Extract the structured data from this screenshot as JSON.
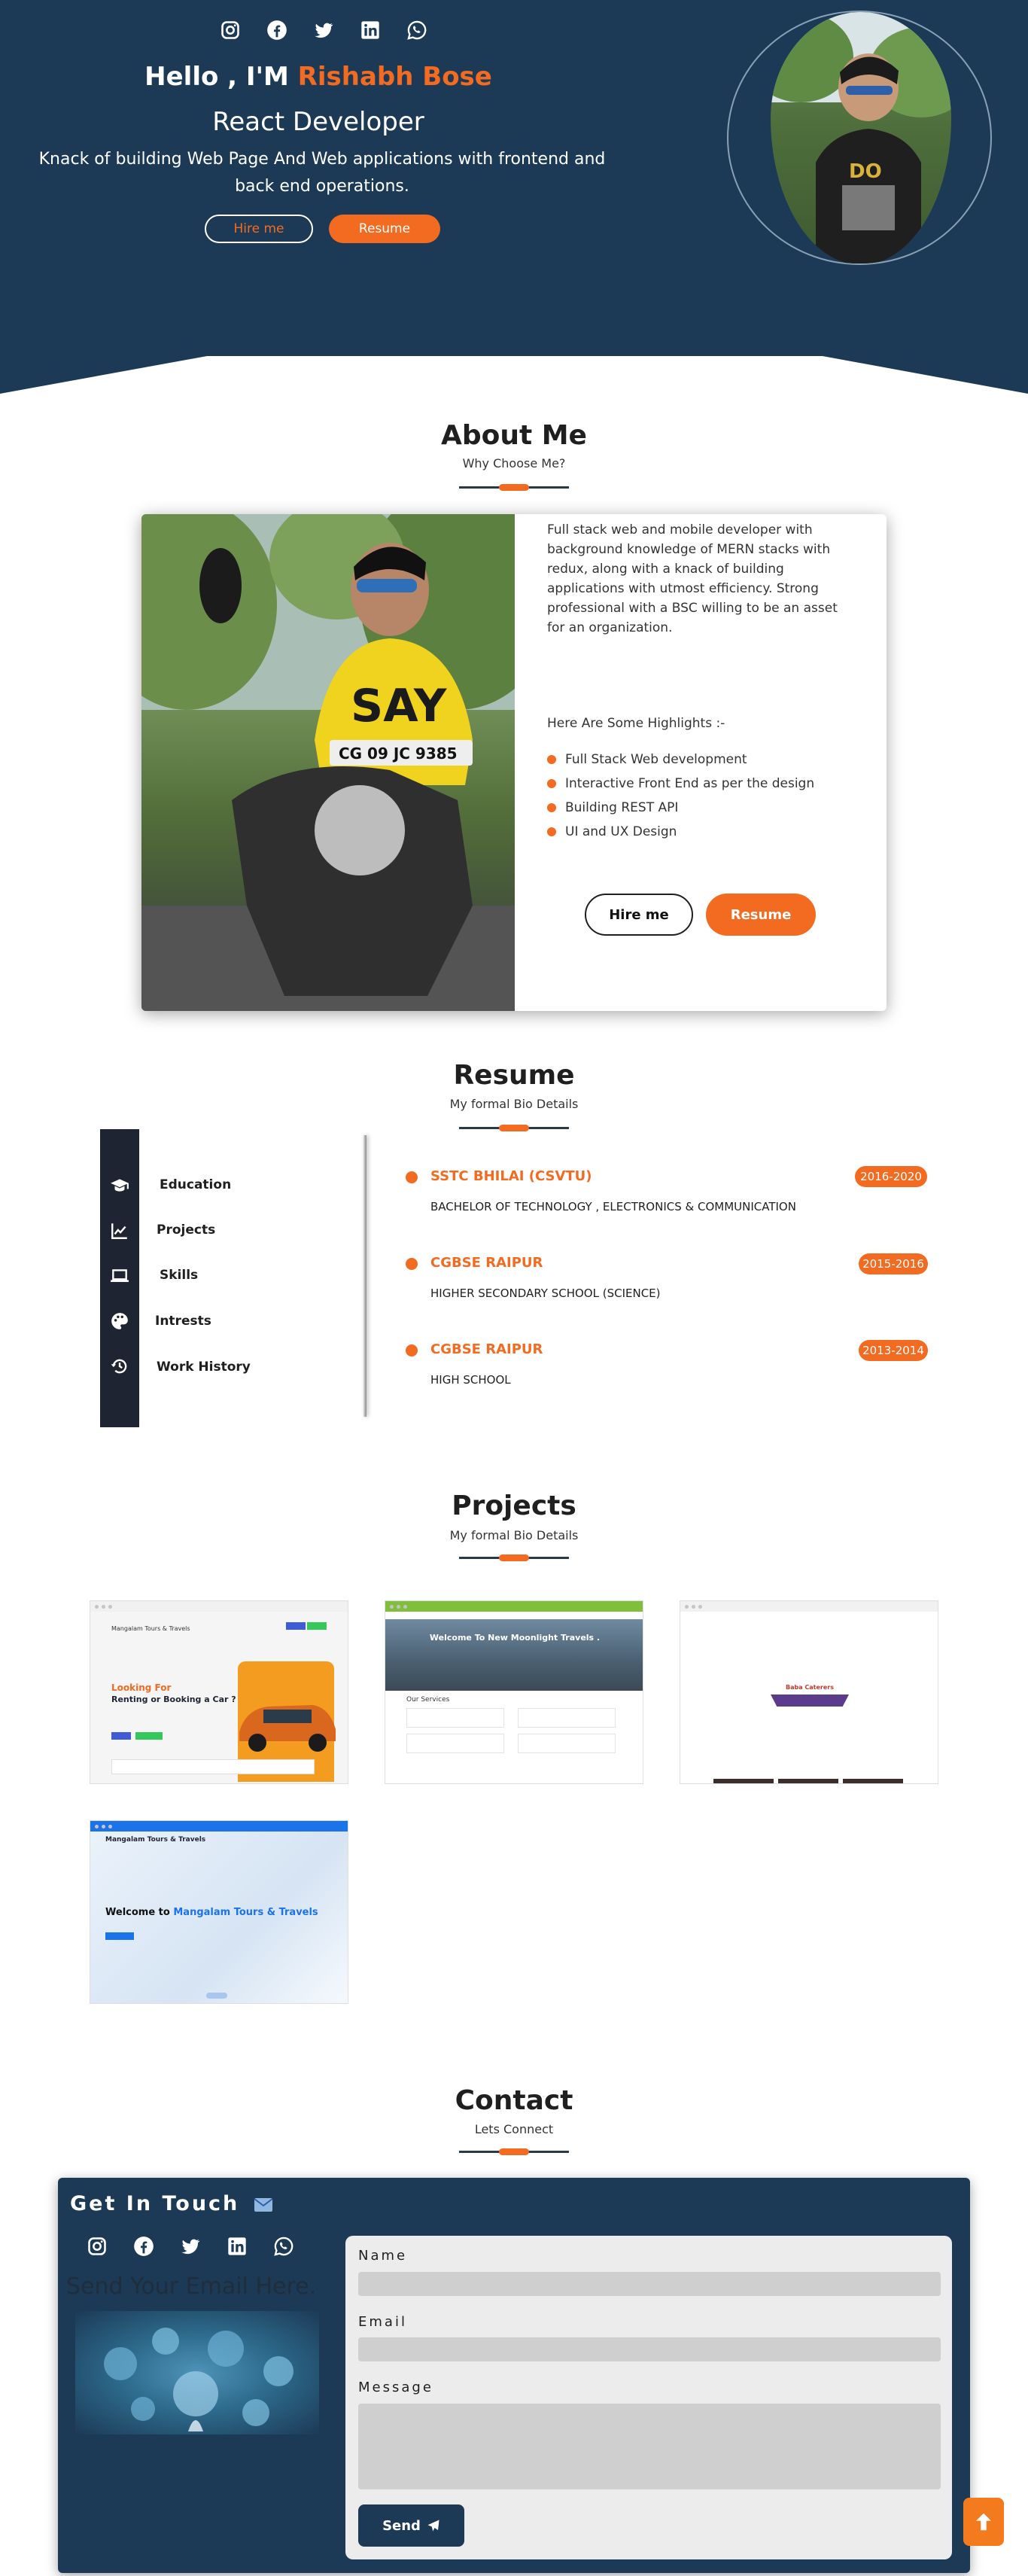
{
  "hero": {
    "social_icons": [
      "instagram-icon",
      "facebook-icon",
      "twitter-icon",
      "linkedin-icon",
      "whatsapp-icon"
    ],
    "greeting": "Hello , I'M",
    "name": "Rishabh Bose",
    "role": "React Developer",
    "tagline": "Knack of building Web Page And Web applications with frontend and back end operations.",
    "hire_label": "Hire me",
    "resume_label": "Resume"
  },
  "about": {
    "title": "About Me",
    "subtitle": "Why Choose Me?",
    "paragraph": "Full stack web and mobile developer with background knowledge of MERN stacks with redux, along with a knack of building applications with utmost efficiency. Strong professional with a BSC willing to be an asset for an organization.",
    "highlights_title": "Here Are Some Highlights :-",
    "highlights": [
      "Full Stack Web development",
      "Interactive Front End as per the design",
      "Building REST API",
      "UI and UX Design"
    ],
    "hire_label": "Hire me",
    "resume_label": "Resume"
  },
  "resume": {
    "title": "Resume",
    "subtitle": "My formal Bio Details",
    "menu": [
      {
        "label": "Education",
        "icon": "graduation-cap-icon"
      },
      {
        "label": "Projects",
        "icon": "chart-line-icon"
      },
      {
        "label": "Skills",
        "icon": "laptop-icon"
      },
      {
        "label": "Intrests",
        "icon": "palette-icon"
      },
      {
        "label": "Work History",
        "icon": "history-icon"
      }
    ],
    "education": [
      {
        "institute": "SSTC BHILAI (CSVTU)",
        "years": "2016-2020",
        "degree": "BACHELOR OF TECHNOLOGY , ELECTRONICS & COMMUNICATION"
      },
      {
        "institute": "CGBSE RAIPUR",
        "years": "2015-2016",
        "degree": "HIGHER SECONDARY SCHOOL (SCIENCE)"
      },
      {
        "institute": "CGBSE RAIPUR",
        "years": "2013-2014",
        "degree": "HIGH SCHOOL"
      }
    ]
  },
  "projects": {
    "title": "Projects",
    "subtitle": "My formal Bio Details",
    "items": [
      {
        "heading_line1": "Looking For",
        "heading_line2": "Renting or Booking a Car ?",
        "brand": "Mangalam Tours & Travels"
      },
      {
        "banner": "Welcome To New Moonlight Travels .",
        "services": "Our Services"
      },
      {
        "brand": "Baba Caterers"
      },
      {
        "brand": "Mangalam Tours & Travels",
        "welcome": "Welcome to",
        "welcome_accent": "Mangalam Tours & Travels"
      }
    ]
  },
  "contact": {
    "title": "Contact",
    "subtitle": "Lets Connect",
    "card_title": "Get In Touch",
    "email_hint": "Send Your Email Here.",
    "name_label": "Name",
    "email_label": "Email",
    "message_label": "Message",
    "send_label": "Send"
  },
  "colors": {
    "navy": "#1c3a56",
    "accent": "#f26b21",
    "sidebar": "#1f2433"
  }
}
